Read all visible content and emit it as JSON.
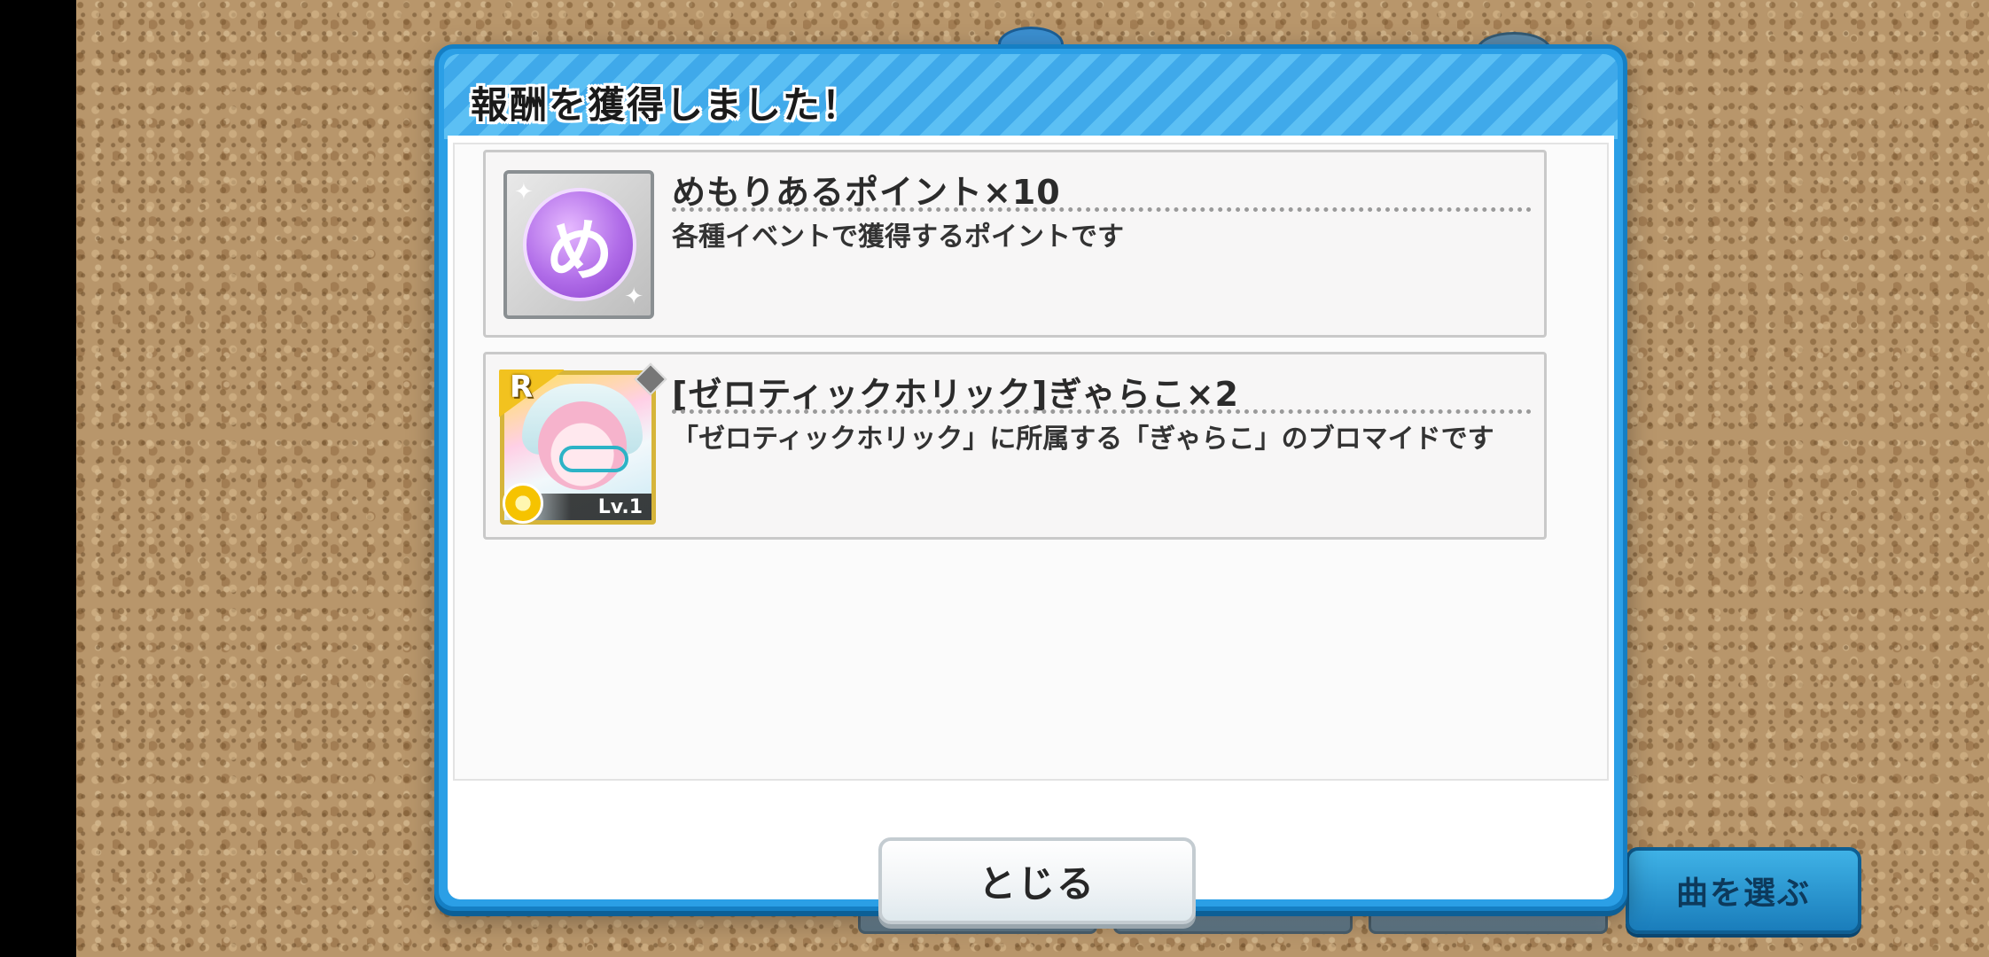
{
  "dialog": {
    "title": "報酬を獲得しました！",
    "close_label": "とじる"
  },
  "rewards": [
    {
      "name": "めもりあるポイント×10",
      "description": "各種イベントで獲得するポイントです",
      "icon_glyph": "め",
      "icon": "memorial-point-coin-icon"
    },
    {
      "name": "[ゼロティックホリック]ぎゃらこ×2",
      "description": "「ゼロティックホリック」に所属する「ぎゃらこ」のブロマイドです",
      "rarity": "R",
      "level": "Lv.1",
      "icon": "character-card-icon"
    }
  ],
  "background": {
    "select_song_label": "曲を選ぶ"
  },
  "colors": {
    "dialog_frame": "#2b9fe6",
    "header_stripe_light": "#5cc0f4",
    "header_stripe_dark": "#3fa9ea",
    "point_purple": "#b06ce8",
    "rarity_gold": "#f2c21f"
  }
}
